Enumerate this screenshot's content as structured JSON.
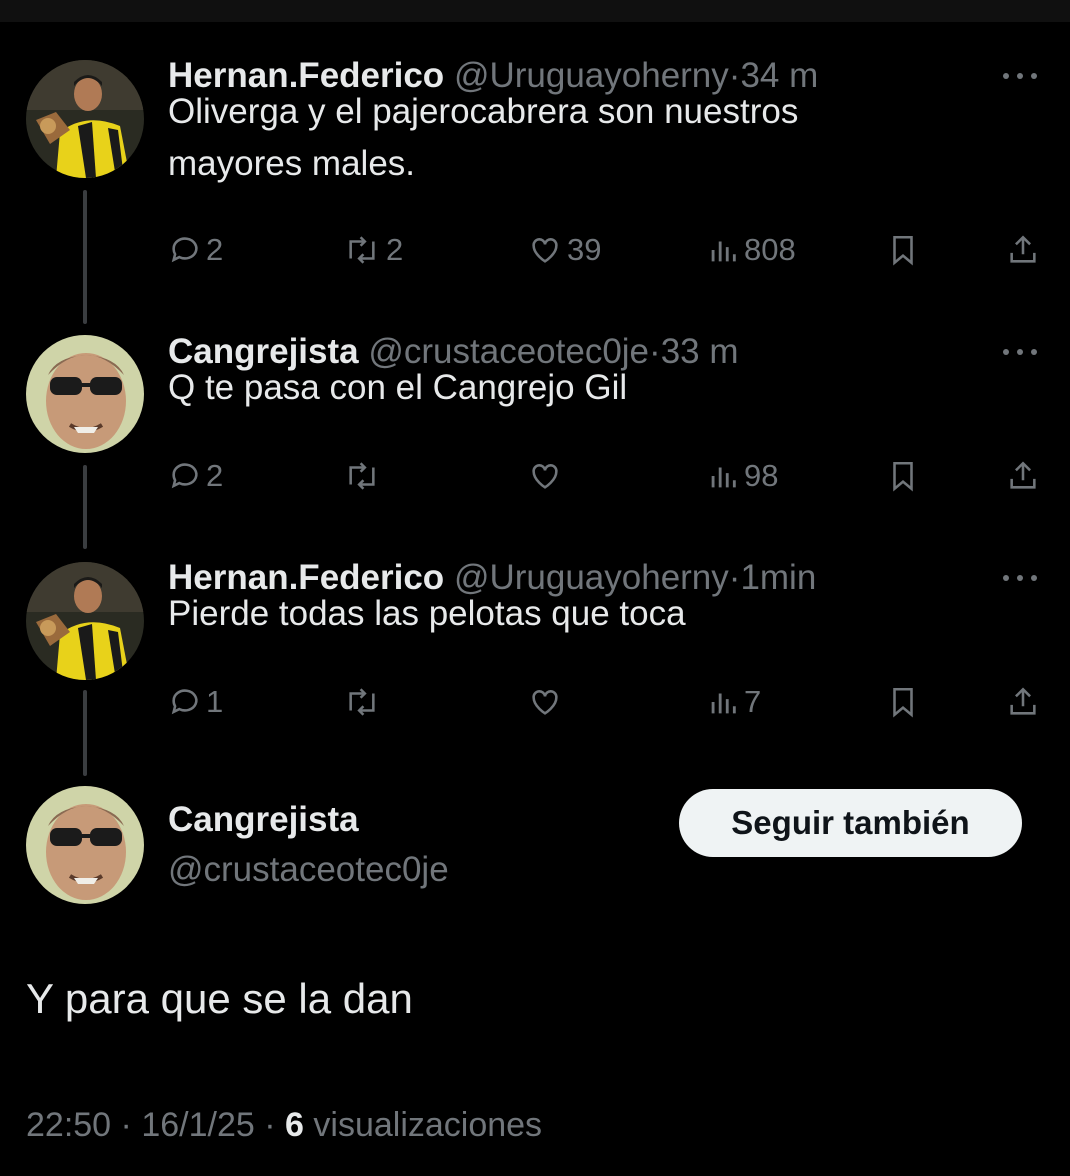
{
  "thread": [
    {
      "name": "Hernan.Federico",
      "handle": "@Uruguayoherny",
      "separator": "·",
      "time": "34 m",
      "text": "Oliverga y el pajerocabrera son nuestros\nmayores males.",
      "avatar_icon": "avatar-player-yellow-black",
      "stats": {
        "replies": "2",
        "reposts": "2",
        "likes": "39",
        "views": "808"
      }
    },
    {
      "name": "Cangrejista",
      "handle": "@crustaceotec0je",
      "separator": "·",
      "time": "33 m",
      "text": "Q te pasa con el Cangrejo Gil",
      "avatar_icon": "avatar-man-sunglasses",
      "stats": {
        "replies": "2",
        "reposts": "",
        "likes": "",
        "views": "98"
      }
    },
    {
      "name": "Hernan.Federico",
      "handle": "@Uruguayoherny",
      "separator": "·",
      "time": "1min",
      "text": "Pierde todas las pelotas que toca",
      "avatar_icon": "avatar-player-yellow-black",
      "stats": {
        "replies": "1",
        "reposts": "",
        "likes": "",
        "views": "7"
      }
    }
  ],
  "main_tweet": {
    "name": "Cangrejista",
    "handle": "@crustaceotec0je",
    "follow_label": "Seguir también",
    "text": "Y para que se la dan",
    "meta": {
      "time": "22:50",
      "separator": "·",
      "date": "16/1/25",
      "views_count": "6",
      "views_label": "visualizaciones"
    }
  },
  "colors": {
    "background": "#000000",
    "primary_text": "#e7e9ea",
    "secondary_text": "#71767b",
    "button_bg": "#eff3f4"
  },
  "icons": [
    "reply-icon",
    "repost-icon",
    "like-icon",
    "views-icon",
    "bookmark-icon",
    "share-icon",
    "more-icon"
  ]
}
